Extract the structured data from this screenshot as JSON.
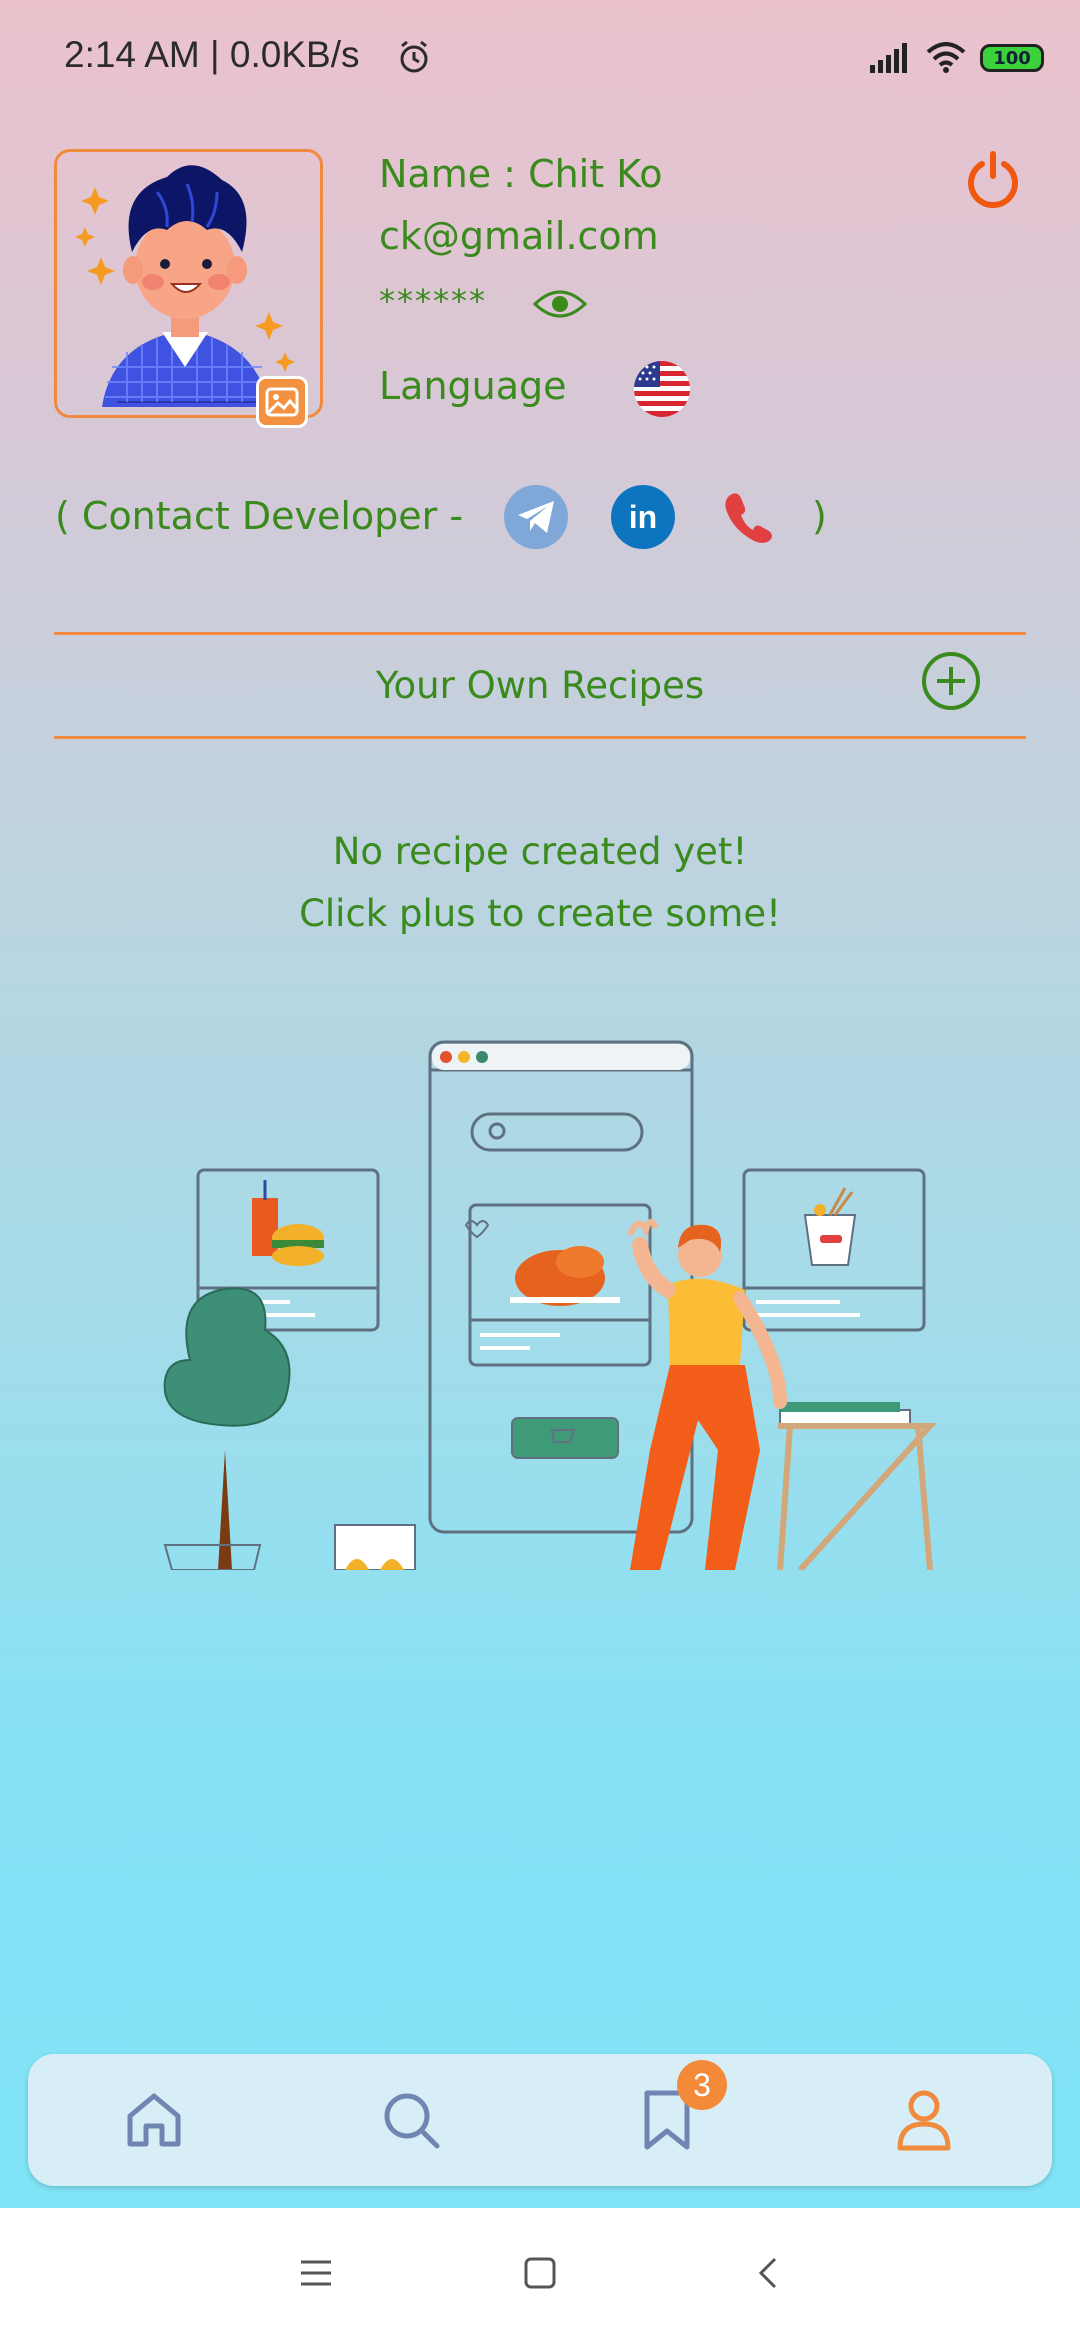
{
  "status_bar": {
    "time": "2:14  AM  |  0.0KB/s",
    "battery": "100"
  },
  "profile": {
    "name": "Name : Chit Ko",
    "email": "ck@gmail.com",
    "password_masked": "******",
    "language_label": "Language",
    "language_flag": "us-flag"
  },
  "contact": {
    "prefix": "( Contact Developer -",
    "suffix": ")",
    "icons": [
      "telegram-icon",
      "linkedin-icon",
      "phone-icon"
    ]
  },
  "recipes": {
    "section_title": "Your Own Recipes",
    "empty_line1": "No recipe created yet!",
    "empty_line2": "Click plus to create some!"
  },
  "bottom_nav": {
    "items": [
      "home-icon",
      "search-icon",
      "bookmark-icon",
      "profile-icon"
    ],
    "bookmark_badge": "3",
    "active": "profile-icon"
  },
  "colors": {
    "text_green": "#3a8a1e",
    "accent_orange": "#f08a3c",
    "nav_inactive": "#6f86b3"
  }
}
